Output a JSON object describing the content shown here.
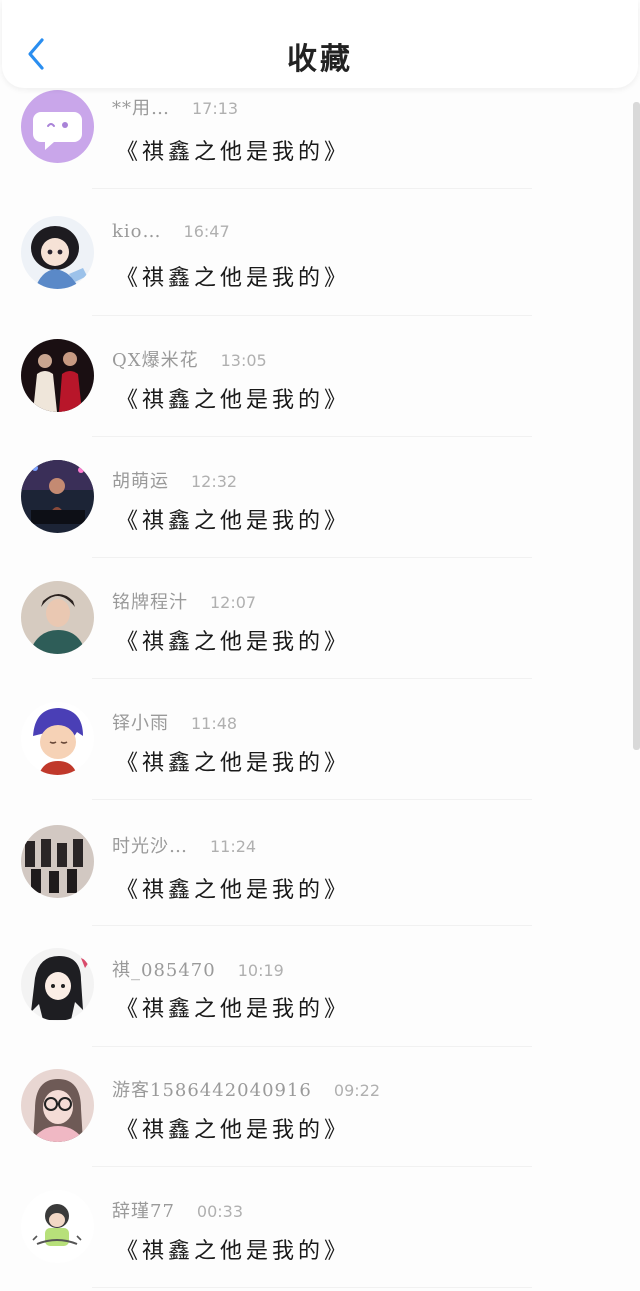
{
  "header": {
    "title": "收藏",
    "back_icon": "chevron-left-icon",
    "accent_color": "#2a8ef0"
  },
  "items": [
    {
      "user": "**用…",
      "time": "17:13",
      "content": "《祺鑫之他是我的》",
      "avatar": "chat-bubble-avatar"
    },
    {
      "user": "kio…",
      "time": "16:47",
      "content": "《祺鑫之他是我的》",
      "avatar": "anime-girl-avatar"
    },
    {
      "user": "QX爆米花",
      "time": "13:05",
      "content": "《祺鑫之他是我的》",
      "avatar": "stage-duo-avatar"
    },
    {
      "user": "胡萌运",
      "time": "12:32",
      "content": "《祺鑫之他是我的》",
      "avatar": "concert-avatar"
    },
    {
      "user": "铭牌程汁",
      "time": "12:07",
      "content": "《祺鑫之他是我的》",
      "avatar": "portrait-avatar"
    },
    {
      "user": "铎小雨",
      "time": "11:48",
      "content": "《祺鑫之他是我的》",
      "avatar": "cartoon-boy-avatar"
    },
    {
      "user": "时光沙…",
      "time": "11:24",
      "content": "《祺鑫之他是我的》",
      "avatar": "group-dance-avatar"
    },
    {
      "user": "祺_085470",
      "time": "10:19",
      "content": "《祺鑫之他是我的》",
      "avatar": "sketch-girl-avatar"
    },
    {
      "user": "游客1586442040916",
      "time": "09:22",
      "content": "《祺鑫之他是我的》",
      "avatar": "glasses-girl-avatar"
    },
    {
      "user": "辞瑾77",
      "time": "00:33",
      "content": "《祺鑫之他是我的》",
      "avatar": "chibi-avatar"
    }
  ]
}
